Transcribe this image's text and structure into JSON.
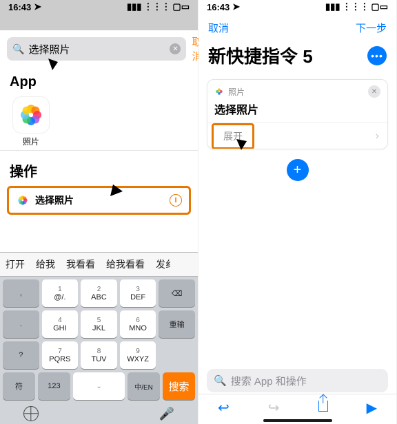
{
  "status": {
    "time": "16:43"
  },
  "left": {
    "search": {
      "value": "选择照片",
      "cancel": "取消"
    },
    "section_app": "App",
    "app_label": "照片",
    "section_actions": "操作",
    "action_label": "选择照片",
    "kb": {
      "suggestions": [
        "打开",
        "给我",
        "我看看",
        "给我看看",
        "发纟"
      ],
      "r1": [
        ",",
        "@/.",
        "ABC",
        "DEF"
      ],
      "r1num": [
        "",
        "1",
        "2",
        "3"
      ],
      "r2": [
        ".",
        "GHI",
        "JKL",
        "MNO",
        "重输"
      ],
      "r2num": [
        "",
        "4",
        "5",
        "6",
        ""
      ],
      "r3": [
        "?",
        "PQRS",
        "TUV",
        "WXYZ"
      ],
      "r3num": [
        "",
        "7",
        "8",
        "9"
      ],
      "r4": [
        "符",
        "123",
        "",
        "中/EN",
        "搜索"
      ]
    }
  },
  "right": {
    "nav_cancel": "取消",
    "nav_next": "下一步",
    "title": "新快捷指令 5",
    "card": {
      "app": "照片",
      "title": "选择照片",
      "expand": "展开"
    },
    "search_placeholder": "搜索 App 和操作"
  }
}
